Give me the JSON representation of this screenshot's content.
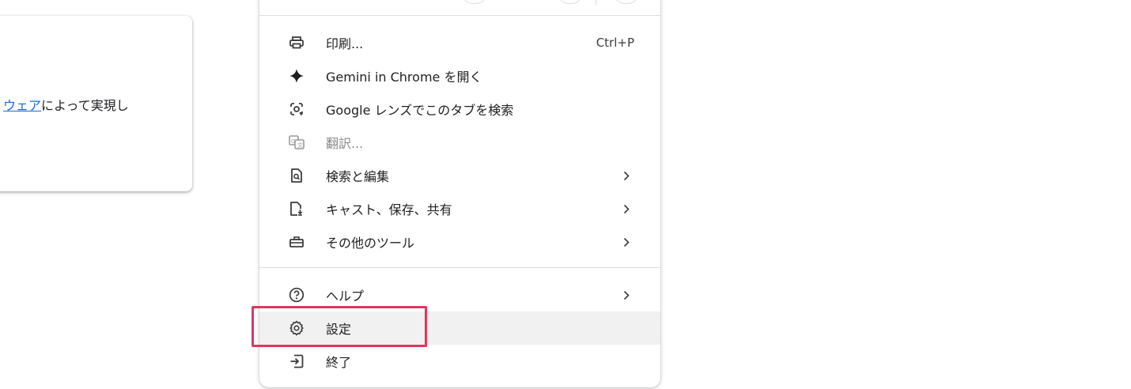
{
  "background_card": {
    "link_text": "ウェア",
    "text": "によって実現し"
  },
  "menu": {
    "items": [
      {
        "label": "印刷...",
        "shortcut": "Ctrl+P",
        "icon": "printer-icon"
      },
      {
        "label": "Gemini in Chrome を開く",
        "icon": "gemini-sparkle-icon"
      },
      {
        "label": "Google レンズでこのタブを検索",
        "icon": "google-lens-icon"
      },
      {
        "label": "翻訳...",
        "icon": "translate-icon",
        "disabled": true
      },
      {
        "label": "検索と編集",
        "icon": "find-edit-icon",
        "submenu": true
      },
      {
        "label": "キャスト、保存、共有",
        "icon": "cast-save-share-icon",
        "submenu": true
      },
      {
        "label": "その他のツール",
        "icon": "toolbox-icon",
        "submenu": true
      },
      {
        "label": "ヘルプ",
        "icon": "help-icon",
        "submenu": true
      },
      {
        "label": "設定",
        "icon": "settings-gear-icon",
        "highlighted": true
      },
      {
        "label": "終了",
        "icon": "exit-icon"
      }
    ]
  },
  "annotation": {
    "highlight_color": "#e0365f",
    "target": "設定"
  }
}
